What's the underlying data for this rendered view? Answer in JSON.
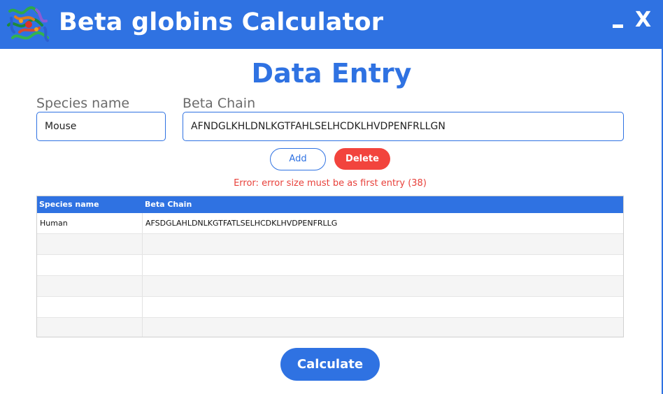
{
  "window": {
    "title": "Beta globins Calculator",
    "minimize_icon": "minimize-icon",
    "close_label": "X",
    "logo_icon": "protein-structure-logo"
  },
  "form": {
    "heading": "Data Entry",
    "species_label": "Species name",
    "species_value": "Mouse",
    "chain_label": "Beta Chain",
    "chain_value": "AFNDGLKHLDNLKGTFAHLSELHCDKLHVDPENFRLLGN",
    "add_label": "Add",
    "delete_label": "Delete",
    "error": "Error: error size must be as first entry (38)"
  },
  "table": {
    "headers": [
      "Species name",
      "Beta Chain"
    ],
    "rows": [
      [
        "Human",
        "AFSDGLAHLDNLKGTFATLSELHCDKLHVDPENFRLLG"
      ],
      [
        "",
        ""
      ],
      [
        "",
        ""
      ],
      [
        "",
        ""
      ],
      [
        "",
        ""
      ],
      [
        "",
        ""
      ]
    ]
  },
  "actions": {
    "calculate_label": "Calculate"
  },
  "colors": {
    "accent": "#2f72e2",
    "danger": "#f2443d",
    "error_text": "#e8413b"
  }
}
